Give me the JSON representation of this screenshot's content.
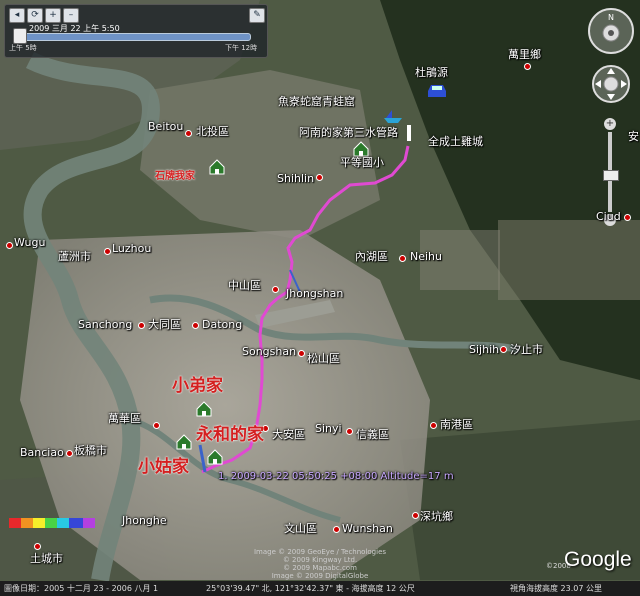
{
  "timeslider": {
    "date_label": "2009 三月 22 上午 5:50",
    "start_label": "上午 5時",
    "end_label": "下午 12時"
  },
  "places": {
    "wanli": "萬里鄉",
    "dupengyuan": "杜鵑源",
    "yuliao": "魚寮蛇窟青蛙窟",
    "anan": "阿南的家第三水管路",
    "pingdeng": "平等國小",
    "quancheng": "全成土雞城",
    "beitou_en": "Beitou",
    "beitou_zh": "北投區",
    "shipai": "石牌我家",
    "shihlin": "Shihlin",
    "wugu": "Wugu",
    "luzhou_zh": "蘆洲市",
    "luzhou_en": "Luzhou",
    "neihu_zh": "內湖區",
    "neihu_en": "Neihu",
    "zhongshan_zh": "中山區",
    "zhongshan_en": "Jhongshan",
    "sanchong": "Sanchong",
    "datong_zh": "大同區",
    "datong_en": "Datong",
    "songshan_en": "Songshan",
    "songshan_zh": "松山區",
    "xizhi_en": "Sijhih",
    "xizhi_zh": "汐止市",
    "wanhua": "萬華區",
    "daan": "大安區",
    "sinyi_en": "Sinyi",
    "sinyi_zh": "信義區",
    "nangang": "南港區",
    "banciao_en": "Banciao",
    "banciao_zh": "板橋市",
    "xiaodi": "小弟家",
    "yonghe": "永和的家",
    "xiaogu": "小姑家",
    "jhonghe": "Jhonghe",
    "wenshan_zh": "文山區",
    "wunshan_en": "Wunshan",
    "shenkeng": "深坑鄉",
    "tucheng": "土城市",
    "right_an": "安",
    "ciudu": "Ciud"
  },
  "gps_point": "1. 2009-03-22 05:50:25 +08:00 Altitude=17 m",
  "credits": {
    "line1": "Image © 2009 GeoEye / Technologies",
    "line2": "© 2009 Kingway Ltd.",
    "line3": "© 2009 Mapabc.com",
    "line4": "Image © 2009 DigitalGlobe"
  },
  "google_logo": "Google",
  "copyright_year": "©2008",
  "status_bar": {
    "left": "圖像日期：2005 十二月 23 - 2006 八月 1",
    "coords": "25°03'39.47\" 北, 121°32'42.37\" 東 - 海拔高度 12 公尺",
    "right": "視角海拔高度 23.07 公里"
  },
  "colors": {
    "track": "#e04ad2",
    "label_red": "#d42020",
    "house": "#2b7a2b"
  }
}
